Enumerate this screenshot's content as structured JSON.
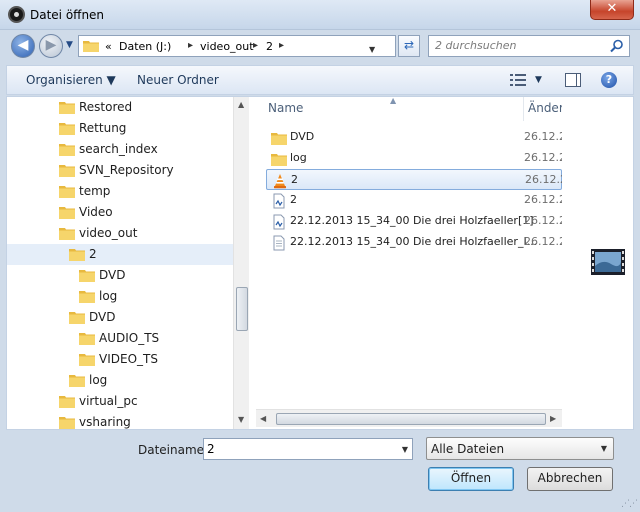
{
  "window": {
    "title": "Datei öffnen",
    "close_label": "✕"
  },
  "address_bar": {
    "overflow": "«",
    "breadcrumbs": [
      "Daten (J:)",
      "video_out",
      "2"
    ],
    "search_placeholder": "2 durchsuchen"
  },
  "command_bar": {
    "organize_label": "Organisieren ▼",
    "new_folder_label": "Neuer Ordner"
  },
  "nav_tree": {
    "items": [
      {
        "label": "Restored"
      },
      {
        "label": "Rettung"
      },
      {
        "label": "search_index"
      },
      {
        "label": "SVN_Repository"
      },
      {
        "label": "temp"
      },
      {
        "label": "Video"
      },
      {
        "label": "video_out"
      },
      {
        "label": "2",
        "selected": true
      },
      {
        "label": "DVD"
      },
      {
        "label": "log"
      },
      {
        "label": "DVD"
      },
      {
        "label": "AUDIO_TS"
      },
      {
        "label": "VIDEO_TS"
      },
      {
        "label": "log"
      },
      {
        "label": "virtual_pc"
      },
      {
        "label": "vsharing"
      }
    ]
  },
  "file_list": {
    "columns": {
      "name": "Name",
      "date": "Änder"
    },
    "rows": [
      {
        "name": "DVD",
        "date": "26.12.2",
        "icon": "folder-icon"
      },
      {
        "name": "log",
        "date": "26.12.2",
        "icon": "folder-icon"
      },
      {
        "name": "2",
        "date": "26.12.2",
        "icon": "vlc-cone-icon",
        "selected": true
      },
      {
        "name": "2",
        "date": "26.12.2",
        "icon": "audio-file-icon"
      },
      {
        "name": "22.12.2013 15_34_00 Die drei Holzfaeller[1]",
        "date": "26.12.2",
        "icon": "audio-file-icon"
      },
      {
        "name": "22.12.2013 15_34_00 Die drei Holzfaeller_I...",
        "date": "26.12.2",
        "icon": "text-file-icon"
      }
    ]
  },
  "footer": {
    "filename_label": "Dateiname:",
    "filename_value": "2",
    "filetype_value": "Alle Dateien",
    "open_label": "Öffnen",
    "cancel_label": "Abbrechen"
  },
  "colors": {
    "accent": "#3c7fb1",
    "folder": "#f2c94c",
    "selection": "#dbe8f8"
  }
}
